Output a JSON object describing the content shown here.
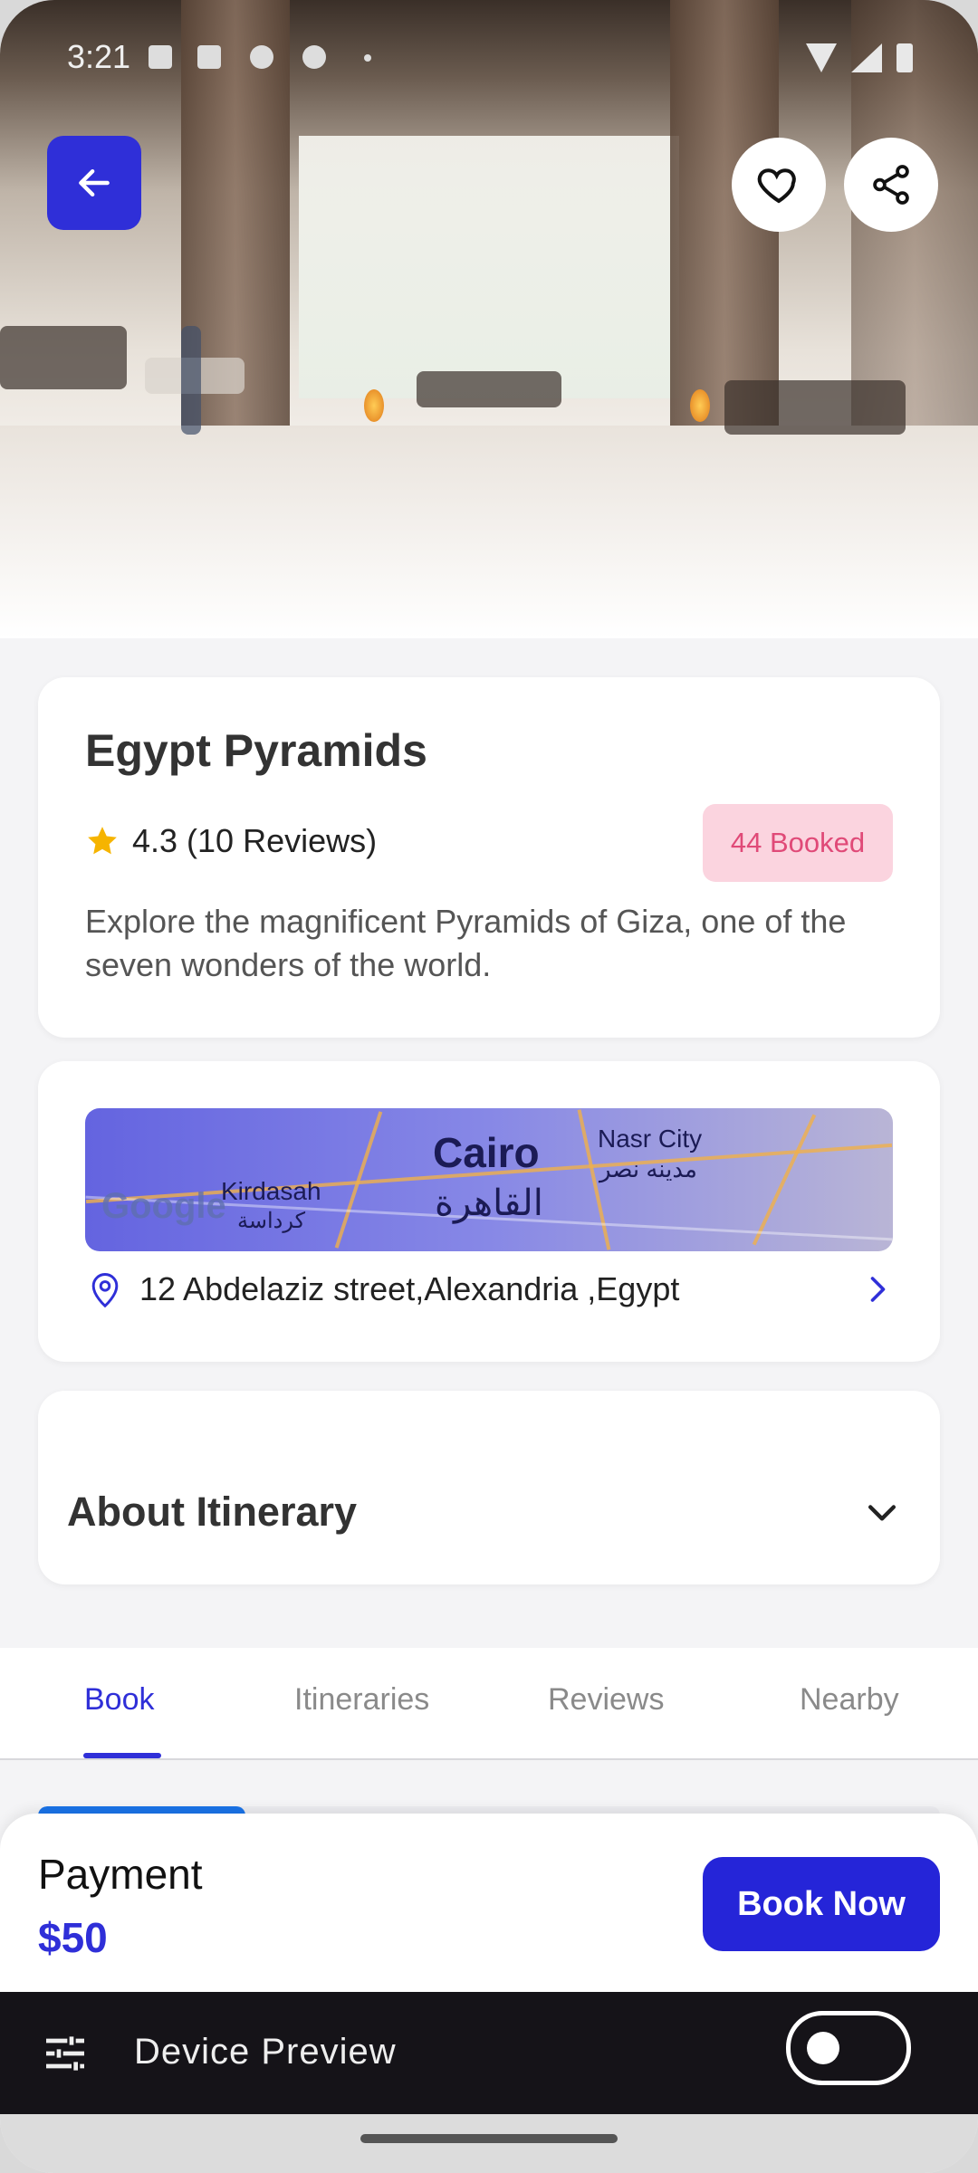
{
  "status_bar": {
    "time": "3:21"
  },
  "header": {
    "back_icon": "arrow-left-icon",
    "favorite_icon": "heart-icon",
    "share_icon": "share-icon"
  },
  "place": {
    "title": "Egypt Pyramids",
    "rating": "4.3",
    "reviews": "(10 Reviews)",
    "booked": "44 Booked",
    "description": "Explore the magnificent Pyramids of Giza, one of the seven wonders of the world."
  },
  "location": {
    "map_labels": [
      "Cairo",
      "القاهرة",
      "Nasr City",
      "مدينه نصر",
      "Kirdasah",
      "كرداسة",
      "Google"
    ],
    "address": "12 Abdelaziz street,Alexandria ,Egypt"
  },
  "about": {
    "title": "About Itinerary"
  },
  "tabs": [
    {
      "label": "Book"
    },
    {
      "label": "Itineraries"
    },
    {
      "label": "Reviews"
    },
    {
      "label": "Nearby"
    }
  ],
  "progress": {
    "fraction": 0.23
  },
  "payment": {
    "label": "Payment",
    "price": "$50",
    "button": "Book Now"
  },
  "device_preview": {
    "label": "Device Preview",
    "enabled": false
  },
  "colors": {
    "primary": "#2f2fd8",
    "badge_bg": "#fbd4df",
    "badge_text": "#e04a78",
    "star": "#f6b400"
  }
}
